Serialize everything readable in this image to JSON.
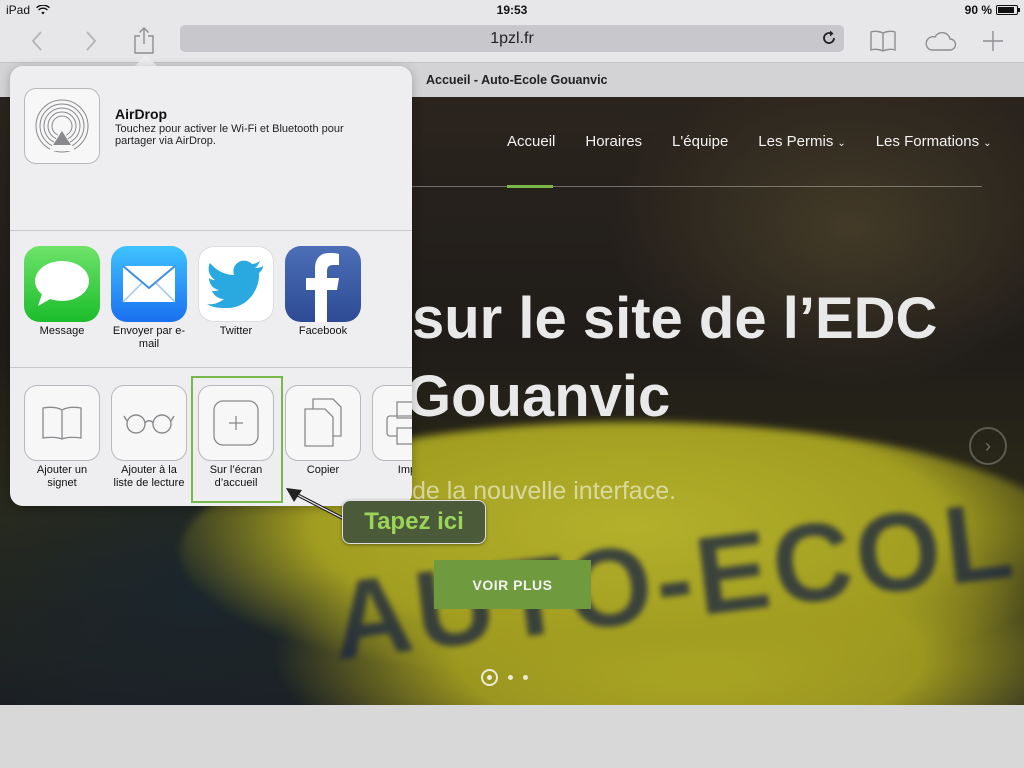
{
  "status": {
    "device": "iPad",
    "time": "19:53",
    "battery": "90 %",
    "battery_level": 0.9
  },
  "browser": {
    "url": "1pzl.fr",
    "tab_title": "Accueil - Auto-Ecole Gouanvic"
  },
  "website": {
    "nav": [
      {
        "label": "Accueil"
      },
      {
        "label": "Horaires"
      },
      {
        "label": "L'équipe"
      },
      {
        "label": "Les Permis"
      },
      {
        "label": "Les Formations"
      }
    ],
    "hero_line1": "sur le site de l’EDC",
    "hero_line2": "Gouanvic",
    "hero_subtitle": "de la nouvelle interface.",
    "cta": "VOIR PLUS",
    "background_text": "AUTO-ECOL"
  },
  "share_sheet": {
    "airdrop_title": "AirDrop",
    "airdrop_description": "Touchez pour activer le Wi-Fi et Bluetooth pour partager via AirDrop.",
    "apps": [
      {
        "label": "Message",
        "icon": "messages-icon"
      },
      {
        "label": "Envoyer par e-mail",
        "icon": "mail-icon"
      },
      {
        "label": "Twitter",
        "icon": "twitter-icon"
      },
      {
        "label": "Facebook",
        "icon": "facebook-icon"
      }
    ],
    "actions": [
      {
        "label": "Ajouter un signet",
        "icon": "book-icon"
      },
      {
        "label": "Ajouter à la liste de lecture",
        "icon": "glasses-icon"
      },
      {
        "label": "Sur l’écran d’accueil",
        "icon": "add-home-icon"
      },
      {
        "label": "Copier",
        "icon": "copy-icon"
      },
      {
        "label": "Impri",
        "icon": "print-icon"
      }
    ]
  },
  "callout": {
    "text": "Tapez ici"
  },
  "colors": {
    "accent_green": "#7ab648",
    "cta_green": "#6f9a3e",
    "callout_text": "#9cd45a"
  }
}
